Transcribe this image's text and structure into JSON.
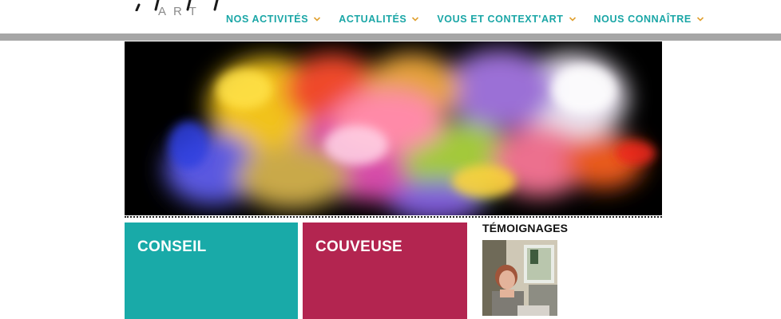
{
  "logo": {
    "marks": "‚ ⁄ ⁄ ‚",
    "text": "ART"
  },
  "nav": {
    "items": [
      {
        "label": "NOS ACTIVITÉS"
      },
      {
        "label": "ACTUALITÉS"
      },
      {
        "label": "VOUS ET CONTEXT'ART"
      },
      {
        "label": "NOUS CONNAÎTRE"
      }
    ]
  },
  "tiles": {
    "conseil": "CONSEIL",
    "couveuse": "COUVEUSE"
  },
  "sidebar": {
    "title": "TÉMOIGNAGES"
  },
  "colors": {
    "nav_teal": "#1aa6a6",
    "conseil_teal": "#19aaa8",
    "couveuse_magenta": "#b32550",
    "gray_bar": "#a6a6a6"
  },
  "icons": {
    "nav_chevron": "chevron-down-icon"
  }
}
